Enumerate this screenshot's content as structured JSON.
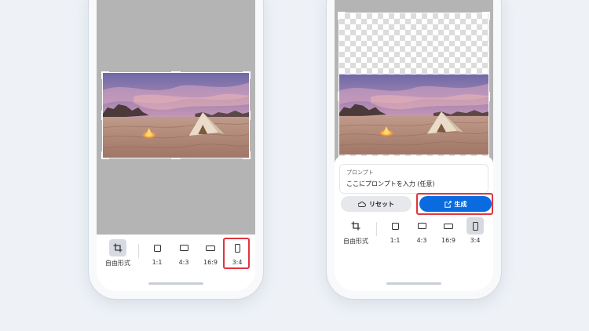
{
  "colors": {
    "accent": "#0a6be0",
    "highlight": "#e0343f",
    "canvas": "#b4b4b4"
  },
  "left_screen": {
    "tools": [
      {
        "label": "自由形式",
        "icon": "crop-icon",
        "selected": true
      },
      {
        "label": "1:1",
        "icon": "square-icon",
        "selected": false
      },
      {
        "label": "4:3",
        "icon": "landscape-rect-icon",
        "selected": false
      },
      {
        "label": "16:9",
        "icon": "wide-rect-icon",
        "selected": false
      },
      {
        "label": "3:4",
        "icon": "portrait-rect-icon",
        "selected": false,
        "highlighted": true
      }
    ]
  },
  "right_screen": {
    "prompt": {
      "label": "プロンプト",
      "placeholder": "ここにプロンプトを入力 (任意)"
    },
    "reset_label": "リセット",
    "generate_label": "生成",
    "tools": [
      {
        "label": "自由形式",
        "icon": "crop-icon",
        "selected": false
      },
      {
        "label": "1:1",
        "icon": "square-icon",
        "selected": false
      },
      {
        "label": "4:3",
        "icon": "landscape-rect-icon",
        "selected": false
      },
      {
        "label": "16:9",
        "icon": "wide-rect-icon",
        "selected": false
      },
      {
        "label": "3:4",
        "icon": "portrait-rect-icon",
        "selected": true
      }
    ]
  }
}
